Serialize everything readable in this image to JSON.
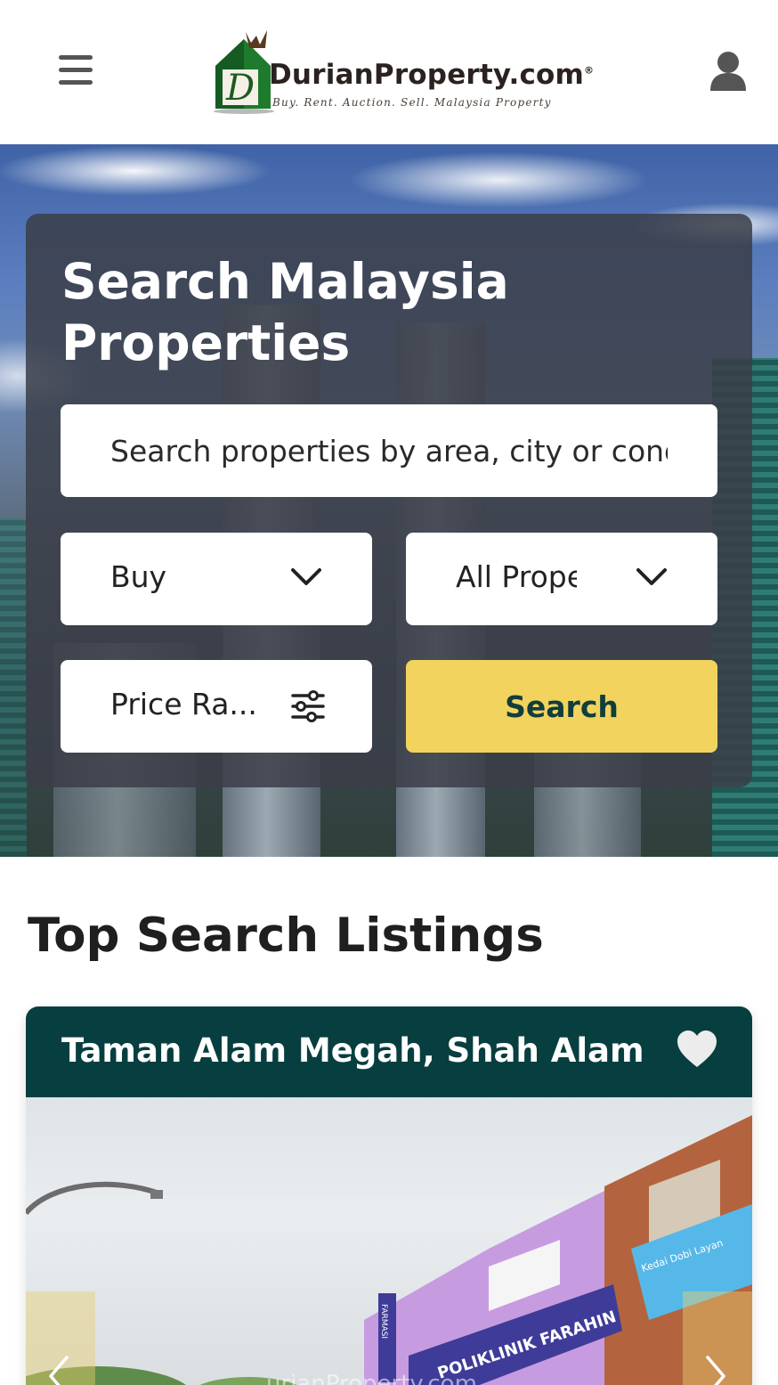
{
  "header": {
    "logo_text": "DurianProperty.com",
    "logo_reg": "®",
    "logo_tagline": "Buy. Rent. Auction. Sell. Malaysia Property",
    "menu_icon": "hamburger-menu-icon",
    "user_icon": "user-icon"
  },
  "hero": {
    "title": "Search Malaysia Properties",
    "search_placeholder": "Search properties by area, city or condo",
    "listing_type": "Buy",
    "property_type": "All Property",
    "price_range": "Price Ra...",
    "search_button": "Search"
  },
  "listings": {
    "section_title": "Top Search Listings",
    "cards": [
      {
        "title": "Taman Alam Megah, Shah Alam",
        "sign_text": "POLIKLINIK FARAHIN",
        "pharmacy_text": "FARMASI",
        "shop_text": "Kedai Dobi Layan",
        "watermark": "urianProperty.com"
      }
    ]
  },
  "colors": {
    "accent": "#f1d35e",
    "card_header": "#073f40",
    "panel": "#3a3e48"
  }
}
